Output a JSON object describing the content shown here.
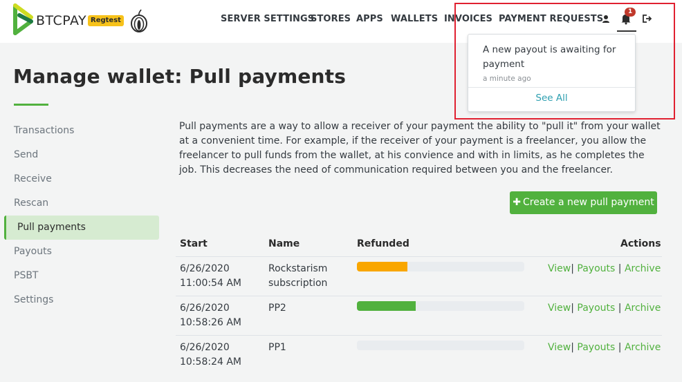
{
  "header": {
    "brand": "BTCPAY",
    "env_badge": "Regtest",
    "nav": [
      "SERVER SETTINGS",
      "STORES",
      "APPS",
      "WALLETS",
      "INVOICES",
      "PAYMENT REQUESTS"
    ],
    "notification_count": "1"
  },
  "notification": {
    "message": "A new payout is awaiting for payment",
    "time": "a minute ago",
    "see_all": "See All"
  },
  "page": {
    "title": "Manage wallet: Pull payments",
    "description": "Pull payments are a way to allow a receiver of your payment the ability to \"pull it\" from your wallet at a convenient time. For example, if the receiver of your payment is a freelancer, you allow the freelancer to pull funds from the wallet, at his convience and with in limits, as he completes the job. This decreases the need of communication required between you and the freelancer.",
    "create_button": "Create a new pull payment"
  },
  "sidebar": {
    "items": [
      "Transactions",
      "Send",
      "Receive",
      "Rescan",
      "Pull payments",
      "Payouts",
      "PSBT",
      "Settings"
    ],
    "active": "Pull payments"
  },
  "table": {
    "headers": [
      "Start",
      "Name",
      "Refunded",
      "Actions"
    ],
    "rows": [
      {
        "date": "6/26/2020",
        "time": "11:00:54 AM",
        "name": "Rockstarism subscription",
        "refunded": 0.3,
        "refunded_color": "#f9a600"
      },
      {
        "date": "6/26/2020",
        "time": "10:58:26 AM",
        "name": "PP2",
        "refunded": 0.35,
        "refunded_color": "#51b13e"
      },
      {
        "date": "6/26/2020",
        "time": "10:58:24 AM",
        "name": "PP1",
        "refunded": 0,
        "refunded_color": "#51b13e"
      }
    ],
    "actions": {
      "view": "View",
      "payouts": "Payouts",
      "archive": "Archive",
      "sep": "|"
    }
  },
  "colors": {
    "accent": "#51b13e",
    "highlight": "#e02030",
    "warning": "#f9a600"
  },
  "icons": [
    "btcpay-logo",
    "tor-onion-icon",
    "user-icon",
    "bell-icon",
    "logout-icon",
    "plus-icon"
  ]
}
